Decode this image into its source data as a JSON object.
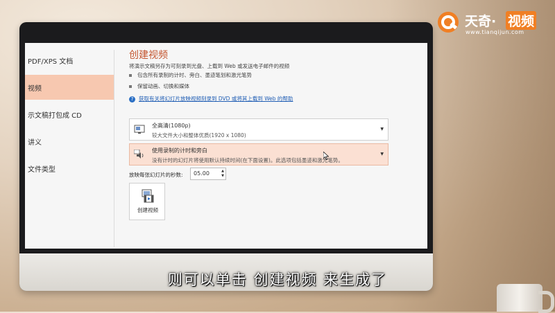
{
  "sidebar": {
    "items": [
      {
        "label": "PDF/XPS 文档",
        "active": false
      },
      {
        "label": "视频",
        "active": true
      },
      {
        "label": "示文稿打包成 CD",
        "active": false
      },
      {
        "label": "讲义",
        "active": false
      },
      {
        "label": "文件类型",
        "active": false
      }
    ]
  },
  "main": {
    "title": "创建视频",
    "description": "将演示文稿另存为可刻录到光盘、上载到 Web 或发送电子邮件的视频",
    "bullets": [
      "包含所有录制的计时、旁白、墨迹笔划和激光笔势",
      "保留动画、切换和媒体"
    ],
    "help_link": "获取有关将幻灯片放映视频刻录到 DVD 或将其上载到 Web 的帮助",
    "quality_dropdown": {
      "main": "全高清(1080p)",
      "sub": "较大文件大小和整体优质(1920 x 1080)"
    },
    "timing_dropdown": {
      "main": "使用录制的计时和旁白",
      "sub": "没有计时的幻灯片将使用默认持续时间(在下面设置)。此选项包括墨迹和激光笔势。"
    },
    "seconds_label": "放映每张幻灯片的秒数:",
    "seconds_value": "05.00",
    "create_button": "创建视频"
  },
  "subtitle": "则可以单击 创建视频 来生成了",
  "logo": {
    "name_part1": "天奇·",
    "name_part2": "视频",
    "url": "www.tianqijun.com"
  },
  "colors": {
    "accent": "#c4552f",
    "active_item": "#f7c8b0",
    "link": "#1f5db4",
    "logo_orange": "#f07f24"
  }
}
